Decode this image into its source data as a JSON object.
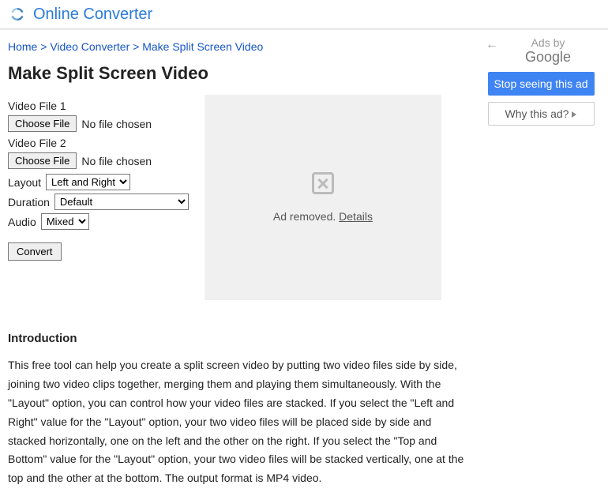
{
  "header": {
    "brand": "Online Converter"
  },
  "breadcrumb": {
    "home": "Home",
    "video_converter": "Video Converter",
    "current": "Make Split Screen Video",
    "sep": ">"
  },
  "page": {
    "title": "Make Split Screen Video"
  },
  "form": {
    "file1_label": "Video File 1",
    "file2_label": "Video File 2",
    "choose_file": "Choose File",
    "no_file": "No file chosen",
    "layout_label": "Layout",
    "layout_value": "Left and Right",
    "duration_label": "Duration",
    "duration_value": "Default",
    "audio_label": "Audio",
    "audio_value": "Mixed",
    "convert": "Convert"
  },
  "adbox": {
    "removed": "Ad removed.",
    "details": "Details"
  },
  "intro": {
    "heading": "Introduction",
    "text": "This free tool can help you create a split screen video by putting two video files side by side, joining two video clips together, merging them and playing them simultaneously. With the \"Layout\" option, you can control how your video files are stacked. If you select the \"Left and Right\" value for the \"Layout\" option, your two video files will be placed side by side and stacked horizontally, one on the left and the other on the right. If you select the \"Top and Bottom\" value for the \"Layout\" option, your two video files will be stacked vertically, one at the top and the other at the bottom. The output format is MP4 video."
  },
  "sidebar": {
    "ads_by": "Ads by",
    "google": "Google",
    "stop": "Stop seeing this ad",
    "why": "Why this ad?"
  }
}
